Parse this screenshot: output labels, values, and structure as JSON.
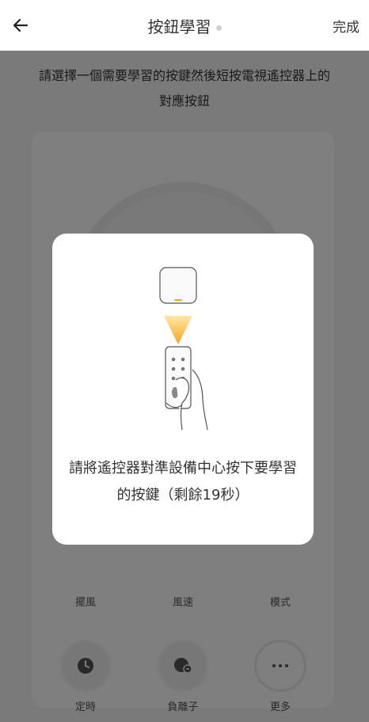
{
  "header": {
    "title": "按鈕學習",
    "done_label": "完成"
  },
  "instruction": "請選擇一個需要學習的按鍵然後短按電視遙控器上的對應按鈕",
  "buttons": [
    {
      "label": "擺風",
      "icon": "swing-icon"
    },
    {
      "label": "風速",
      "icon": "fan-speed-icon"
    },
    {
      "label": "模式",
      "icon": "mode-icon"
    },
    {
      "label": "定時",
      "icon": "clock-icon"
    },
    {
      "label": "負離子",
      "icon": "ion-icon"
    },
    {
      "label": "更多",
      "icon": "more-icon"
    }
  ],
  "modal": {
    "message": "請將遙控器對準設備中心按下要學習的按鍵（剩餘19秒）"
  },
  "colors": {
    "accent": "#F5A623",
    "overlay": "rgba(0,0,0,0.5)"
  }
}
